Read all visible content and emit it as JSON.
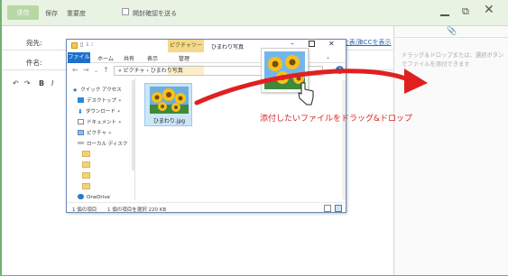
{
  "toolbar": {
    "send_label": "送信",
    "save_label": "保存",
    "importance_label": "重要度",
    "receipt_label": "開封確認を送る",
    "checkbox_label": "開封確認を送る"
  },
  "fields": {
    "to_label": "宛先:",
    "subject_label": "件名:",
    "cc_link": "CCを表示",
    "bcc_link": "BCCを表示"
  },
  "editor": {
    "bold": "B",
    "italic": "I",
    "undo": "↶"
  },
  "attachments": {
    "hint": "ドラッグ＆ドロップまたは、選択ボタンでファイルを添付できます"
  },
  "explorer": {
    "title": "ひまわり写真",
    "tools_tab": "ピクチャツール",
    "tabs": [
      "ファイル",
      "ホーム",
      "共有",
      "表示",
      "管理"
    ],
    "address": "« ピクチャ › ひまわり写真",
    "nav_items": [
      {
        "label": "クイック アクセス"
      },
      {
        "label": "デスクトップ"
      },
      {
        "label": "ダウンロード"
      },
      {
        "label": "ドキュメント"
      },
      {
        "label": "ピクチャ"
      },
      {
        "label": "ローカル ディスク"
      },
      {
        "label": "OneDrive"
      }
    ],
    "file": {
      "name": "ひまわり.jpg"
    },
    "status_count": "1 個の項目",
    "status_selected": "1 個の項目を選択  220 KB"
  },
  "annotation": {
    "text": "添付したいファイルをドラッグ&ドロップ",
    "color": "#e02020"
  },
  "colors": {
    "accent_green": "#6fb26f",
    "explorer_blue": "#1e70c9"
  }
}
